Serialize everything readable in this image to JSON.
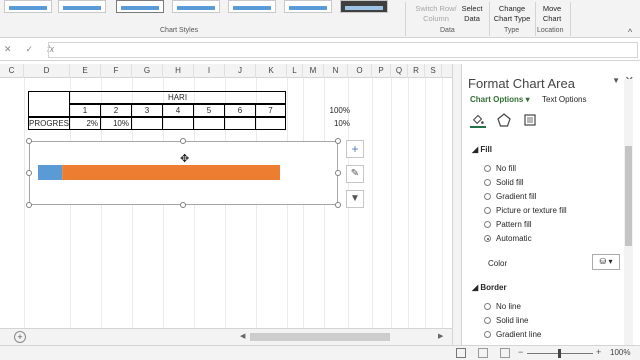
{
  "ribbon": {
    "chart_styles_label": "Chart Styles",
    "data_group_label": "Data",
    "type_group_label": "Type",
    "location_group_label": "Location",
    "switch_row_col": "Switch Row/\nColumn",
    "select_data": "Select\nData",
    "change_chart_type": "Change\nChart Type",
    "move_chart": "Move\nChart"
  },
  "formula_bar": {
    "cancel_icon": "cancel-icon",
    "confirm_icon": "confirm-icon",
    "fx_label": "fx",
    "value": ""
  },
  "columns": [
    "C",
    "D",
    "E",
    "F",
    "G",
    "H",
    "I",
    "J",
    "K",
    "L",
    "M",
    "N",
    "O",
    "P",
    "Q",
    "R",
    "S"
  ],
  "table": {
    "hari_label": "HARI",
    "days": [
      "1",
      "2",
      "3",
      "4",
      "5",
      "6",
      "7"
    ],
    "progres_label": "PROGRES",
    "progres_values": [
      "2%",
      "10%",
      "",
      "",
      "",
      "",
      ""
    ],
    "n_col_header": "100%",
    "n_col_value": "10%"
  },
  "chart_data": {
    "type": "bar",
    "categories": [
      ""
    ],
    "series": [
      {
        "values": [
          10
        ],
        "color": "#5b9bd5"
      },
      {
        "values": [
          90
        ],
        "color": "#ed7d31"
      }
    ],
    "stacked": true,
    "orientation": "horizontal",
    "xlim": [
      0,
      100
    ],
    "title": "",
    "xlabel": "",
    "ylabel": "",
    "grid": false,
    "legend": "none"
  },
  "chart_side_buttons": [
    "plus-icon",
    "brush-icon",
    "filter-icon"
  ],
  "pane": {
    "title": "Format Chart Area",
    "tab_chart_options": "Chart Options",
    "tab_text_options": "Text Options",
    "fill_section": "Fill",
    "fill_options": [
      "No fill",
      "Solid fill",
      "Gradient fill",
      "Picture or texture fill",
      "Pattern fill",
      "Automatic"
    ],
    "fill_selected": "Automatic",
    "color_label": "Color",
    "border_section": "Border",
    "border_options": [
      "No line",
      "Solid line",
      "Gradient line"
    ]
  },
  "status": {
    "zoom": "100%"
  },
  "colors": {
    "accent": "#217346",
    "series_blue": "#5b9bd5",
    "series_orange": "#ed7d31"
  }
}
